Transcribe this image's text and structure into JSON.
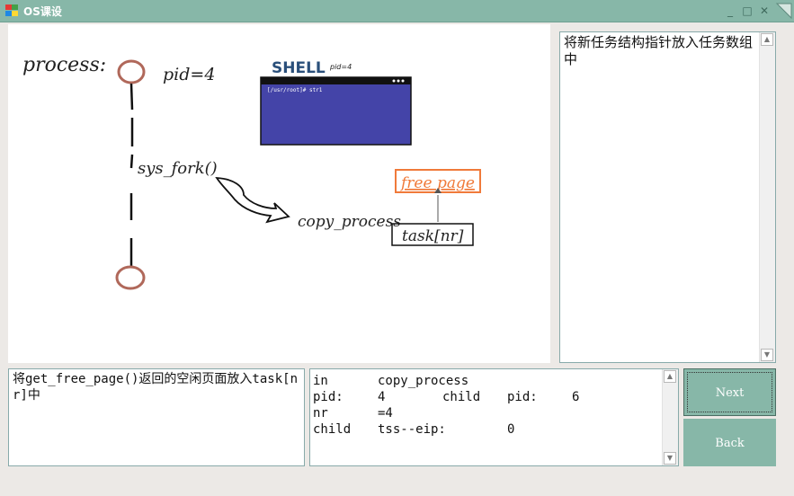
{
  "window": {
    "title": "OS课设",
    "controls": {
      "minimize": "_",
      "maximize": "□",
      "close": "✕"
    }
  },
  "diagram": {
    "process_label": "process:",
    "pid_label": "pid=4",
    "shell_title": "SHELL",
    "shell_pid": "pid=4",
    "terminal_prompt": "[/usr/root]# str1",
    "syscall_label": "sys_fork()",
    "copy_process_label": "copy_process",
    "free_page_label": "free page",
    "task_label": "task[nr]",
    "colors": {
      "node": "#b0685a",
      "terminal": "#4444a8",
      "free_page": "#f07a3a"
    }
  },
  "info_panel": {
    "text": "将新任务结构指针放入任务数组中"
  },
  "description_panel": {
    "text": "将get_free_page()返回的空闲页面放入task[nr]中"
  },
  "state_panel": {
    "rows": [
      [
        "in",
        "copy_process",
        "",
        "",
        ""
      ],
      [
        "pid:",
        "4",
        "child",
        "pid:",
        "6"
      ],
      [
        "nr",
        "=4",
        "",
        "",
        ""
      ],
      [
        "child",
        "tss--eip:",
        "",
        "0",
        ""
      ]
    ]
  },
  "buttons": {
    "next_label": "Next",
    "back_label": "Back"
  }
}
